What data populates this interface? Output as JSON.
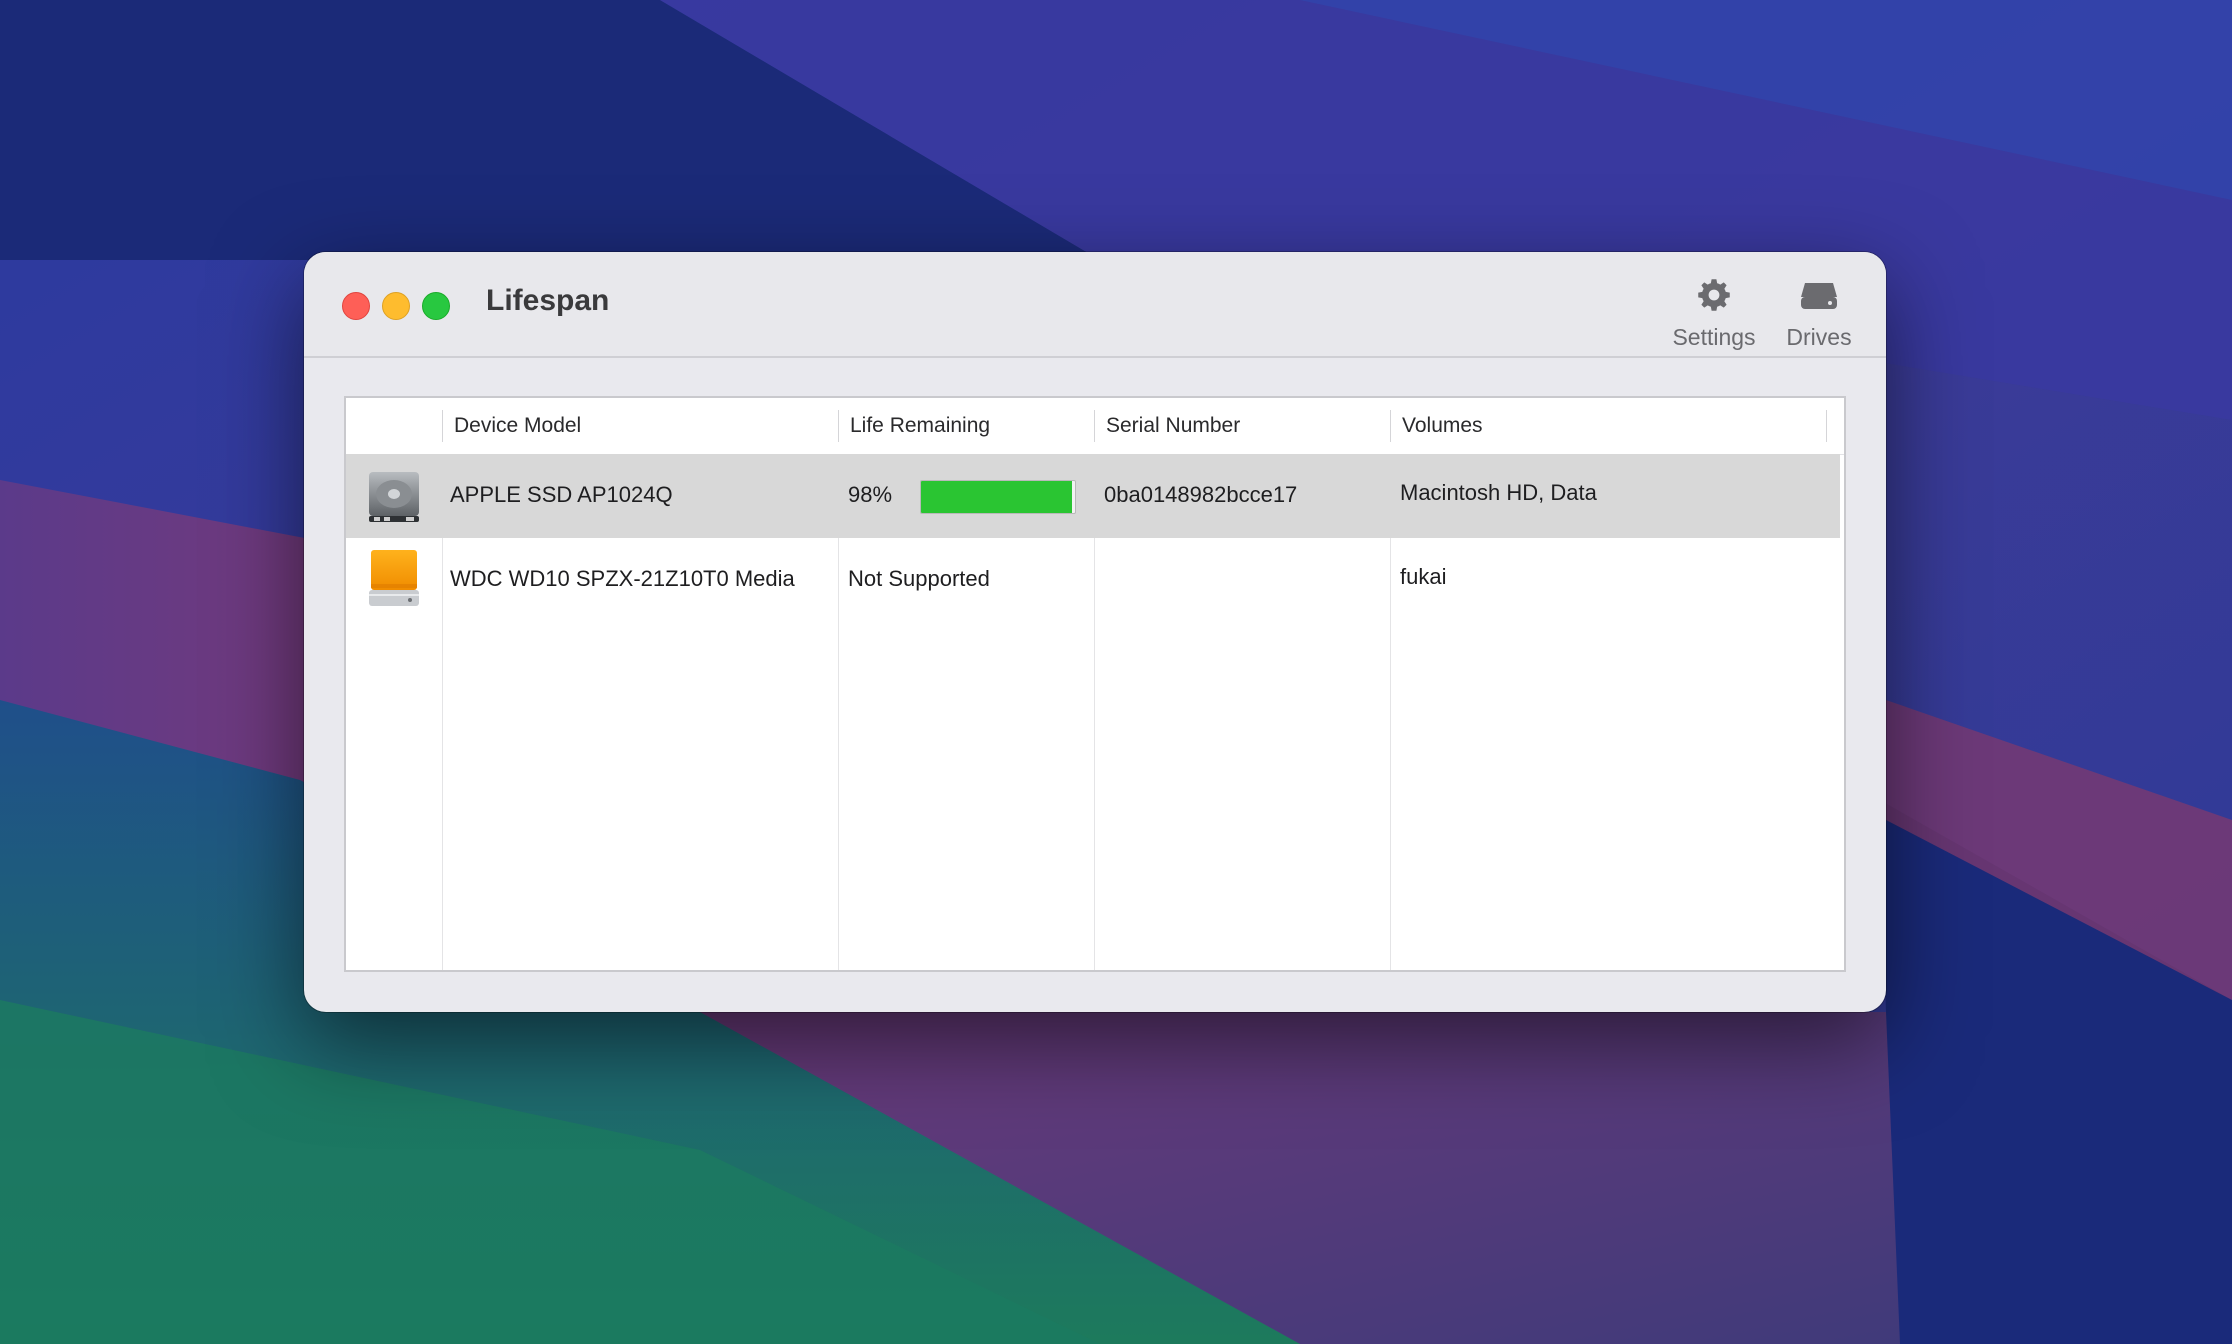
{
  "window": {
    "title": "Lifespan"
  },
  "toolbar": {
    "settings_label": "Settings",
    "settings_icon": "gear-icon",
    "drives_label": "Drives",
    "drives_icon": "external-drive-icon"
  },
  "table": {
    "columns": [
      "",
      "Device Model",
      "Life Remaining",
      "Serial Number",
      "Volumes"
    ],
    "rows": [
      {
        "icon": "internal-ssd-icon",
        "device_model": "APPLE SSD AP1024Q",
        "life_remaining": "98%",
        "life_fraction": 0.98,
        "serial_number": "0ba0148982bcce17",
        "volumes": "Macintosh HD, Data",
        "selected": true
      },
      {
        "icon": "external-hdd-icon",
        "device_model": "WDC WD10 SPZX-21Z10T0 Media",
        "life_remaining": "Not Supported",
        "serial_number": "",
        "volumes": "fukai",
        "selected": false
      }
    ]
  },
  "colors": {
    "progress_fill": "#2ac532",
    "selected_row": "#d8d8d8",
    "close": "#fe5f57",
    "minimize": "#febc2e",
    "zoom": "#28c840"
  }
}
